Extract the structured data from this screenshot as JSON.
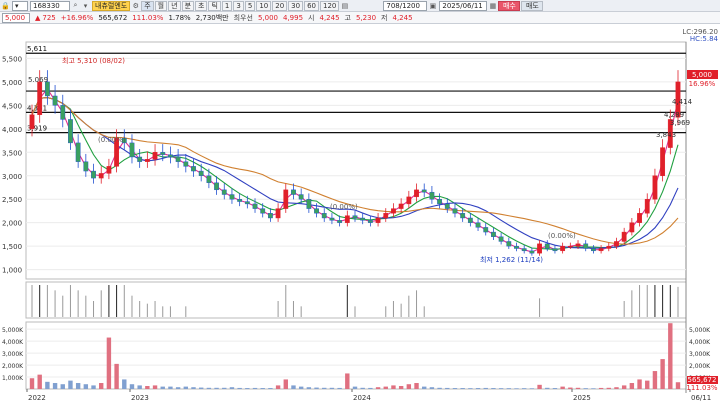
{
  "toolbar": {
    "code": "168330",
    "name_badge": "내츄럴엔도",
    "periods": [
      "주",
      "월",
      "년",
      "분",
      "초",
      "틱"
    ],
    "minutes": [
      "1",
      "3",
      "5",
      "10",
      "20",
      "30",
      "60",
      "120"
    ],
    "range": "708/1200",
    "date": "2025/06/11",
    "buy": "매수",
    "sell": "매도"
  },
  "quote": {
    "price": "5,000",
    "change": "725",
    "change_pct": "+16.96%",
    "volume": "565,672",
    "volume_ratio": "111.03%",
    "turnover_pct": "1.78%",
    "amount": "2,730백만",
    "best_label": "최우선",
    "best_ask": "5,000",
    "best_bid": "4,995",
    "open_label": "시",
    "open": "4,245",
    "high_label": "고",
    "high": "5,230",
    "low_label": "저",
    "low": "4,245"
  },
  "chart_data": {
    "type": "candlestick",
    "x_ticks": [
      "2022",
      "2023",
      "2024",
      "2025",
      "06/11"
    ],
    "price_axis": {
      "ticks": [
        1000,
        1500,
        2000,
        2500,
        3000,
        3500,
        4000,
        4500,
        5000,
        5500
      ],
      "labels": [
        "1,000",
        "1,500",
        "2,000",
        "2,500",
        "3,000",
        "3,500",
        "4,000",
        "4,500",
        "5,000",
        "5,500"
      ],
      "ylim": [
        800,
        5850
      ]
    },
    "volume_axis": {
      "ticks": [
        1000000,
        2000000,
        3000000,
        4000000,
        5000000
      ],
      "labels": [
        "1,000K",
        "2,000K",
        "3,000K",
        "4,000K",
        "5,000K"
      ],
      "ylim": [
        0,
        5600000
      ]
    },
    "header_right": [
      "LC:296.20",
      "HC:5.84"
    ],
    "right_tags": {
      "price": "5,000",
      "pct": "16.96%",
      "vol": "565,672",
      "vol_pct": "111.03%"
    },
    "horizontal_lines": [
      {
        "value": 5611,
        "label": "5,611"
      },
      {
        "value": 4805,
        "label": ""
      },
      {
        "value": 4351,
        "label": "4,351"
      },
      {
        "value": 3919,
        "label": "3,919"
      }
    ],
    "annotations": {
      "high": {
        "label": "최고 5,310 (08/02)",
        "price": 5310
      },
      "low": {
        "label": "최저 1,262 (11/14)",
        "price": 1262
      },
      "mid1": "5.069",
      "value_labels": [
        "4,414",
        "4,289",
        "3,969",
        "3,843"
      ],
      "ratio_labels": [
        "(0.00%)",
        "(0.00%)",
        "(0.00%)"
      ]
    },
    "candles_close": [
      4300,
      5000,
      4700,
      4500,
      4200,
      3700,
      3300,
      3100,
      2950,
      3050,
      3200,
      3800,
      3700,
      3400,
      3300,
      3350,
      3500,
      3450,
      3400,
      3300,
      3200,
      3100,
      3000,
      2850,
      2700,
      2600,
      2500,
      2450,
      2400,
      2300,
      2200,
      2100,
      2300,
      2700,
      2600,
      2500,
      2300,
      2200,
      2100,
      2050,
      2000,
      2150,
      2100,
      2050,
      2000,
      2100,
      2200,
      2300,
      2400,
      2550,
      2700,
      2650,
      2500,
      2400,
      2300,
      2200,
      2100,
      2000,
      1900,
      1800,
      1700,
      1600,
      1500,
      1450,
      1400,
      1350,
      1550,
      1450,
      1400,
      1500,
      1500,
      1550,
      1450,
      1400,
      1450,
      1500,
      1600,
      1800,
      2000,
      2200,
      2500,
      3000,
      3600,
      4200,
      5000
    ],
    "candles_open": [
      4000,
      4300,
      5000,
      4700,
      4500,
      4200,
      3700,
      3300,
      3100,
      2950,
      3050,
      3200,
      3800,
      3700,
      3400,
      3300,
      3350,
      3500,
      3450,
      3400,
      3300,
      3200,
      3100,
      3000,
      2850,
      2700,
      2600,
      2500,
      2450,
      2400,
      2300,
      2200,
      2100,
      2300,
      2700,
      2600,
      2500,
      2300,
      2200,
      2100,
      2050,
      2000,
      2150,
      2100,
      2050,
      2000,
      2100,
      2200,
      2300,
      2400,
      2550,
      2700,
      2650,
      2500,
      2400,
      2300,
      2200,
      2100,
      2000,
      1900,
      1800,
      1700,
      1600,
      1500,
      1450,
      1400,
      1350,
      1550,
      1450,
      1400,
      1500,
      1500,
      1550,
      1450,
      1400,
      1450,
      1500,
      1600,
      1800,
      2000,
      2200,
      2500,
      3000,
      3600,
      4245
    ],
    "volume": [
      900000,
      1200000,
      600000,
      500000,
      400000,
      700000,
      500000,
      400000,
      300000,
      500000,
      4300000,
      2100000,
      800000,
      400000,
      300000,
      250000,
      300000,
      200000,
      200000,
      150000,
      200000,
      150000,
      120000,
      100000,
      100000,
      100000,
      150000,
      90000,
      80000,
      90000,
      80000,
      80000,
      300000,
      800000,
      300000,
      200000,
      150000,
      120000,
      100000,
      100000,
      90000,
      1300000,
      200000,
      100000,
      90000,
      150000,
      200000,
      300000,
      250000,
      400000,
      500000,
      200000,
      150000,
      100000,
      90000,
      80000,
      80000,
      70000,
      80000,
      90000,
      80000,
      70000,
      70000,
      60000,
      70000,
      60000,
      350000,
      100000,
      80000,
      200000,
      120000,
      100000,
      70000,
      60000,
      90000,
      100000,
      150000,
      300000,
      500000,
      800000,
      700000,
      1500000,
      2500000,
      5500000,
      565672
    ]
  }
}
